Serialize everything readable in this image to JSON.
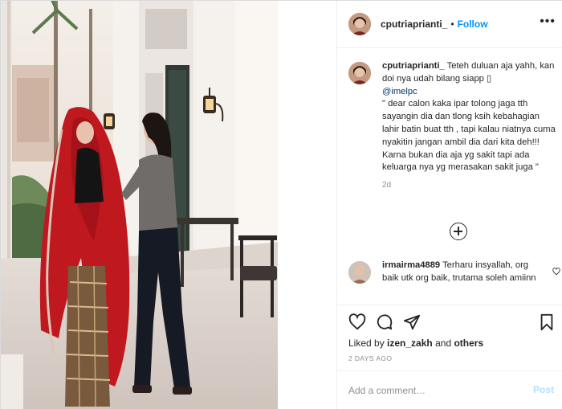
{
  "post": {
    "username": "cputriaprianti_",
    "follow_label": "Follow",
    "separator": "•",
    "more_label": "•••"
  },
  "caption": {
    "username": "cputriaprianti_",
    "line1": "Teteh duluan aja yahh, kan doi nya udah bilang siapp",
    "mention": "@imelpc",
    "line2": "\" dear calon kaka ipar tolong jaga tth sayangin dia dan tlong ksih kebahagian lahir batin buat tth , tapi kalau niatnya cuma nyakitin jangan ambil dia dari kita deh!!! Karna bukan dia aja yg sakit tapi ada keluarga nya yg merasakan sakit juga \"",
    "time": "2d"
  },
  "comments": [
    {
      "username": "irmairma4889",
      "text": "Terharu insyallah, org baik utk org baik, trutama soleh amiinn"
    }
  ],
  "likes": {
    "prefix": "Liked by",
    "user": "izen_zakh",
    "conj": "and",
    "others": "others"
  },
  "date": "2 DAYS AGO",
  "add_comment": {
    "placeholder": "Add a comment…",
    "post_label": "Post"
  },
  "colors": {
    "link": "#0095f6",
    "post_disabled": "#b2dffc",
    "muted": "#8e8e8e",
    "text": "#262626",
    "mention": "#00376b"
  },
  "icons": [
    "heart-icon",
    "comment-icon",
    "share-icon",
    "bookmark-icon",
    "plus-circle-icon",
    "more-icon"
  ]
}
